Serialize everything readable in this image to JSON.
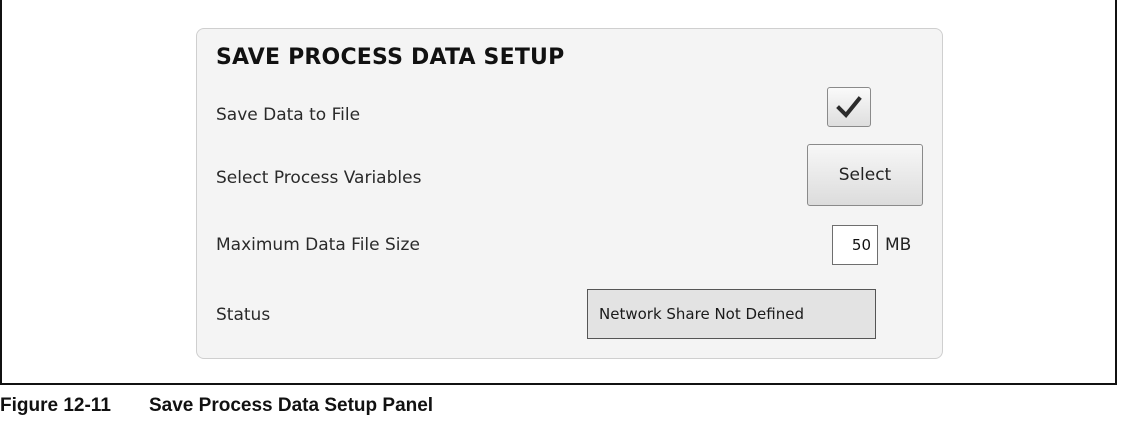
{
  "panel": {
    "title": "SAVE PROCESS DATA SETUP",
    "rows": {
      "save_to_file": {
        "label": "Save Data to File",
        "checked": true
      },
      "process_variables": {
        "label": "Select Process Variables",
        "button_label": "Select"
      },
      "max_file_size": {
        "label": "Maximum Data File Size",
        "value": "50",
        "unit": "MB"
      },
      "status": {
        "label": "Status",
        "value": "Network Share Not Defined"
      }
    },
    "icons": {
      "checkbox": "checkmark-icon"
    },
    "colors": {
      "panel_background": "#f4f4f4",
      "status_background": "#e3e3e3"
    }
  },
  "caption": {
    "number": "Figure 12-11",
    "title": "Save Process Data Setup Panel"
  }
}
